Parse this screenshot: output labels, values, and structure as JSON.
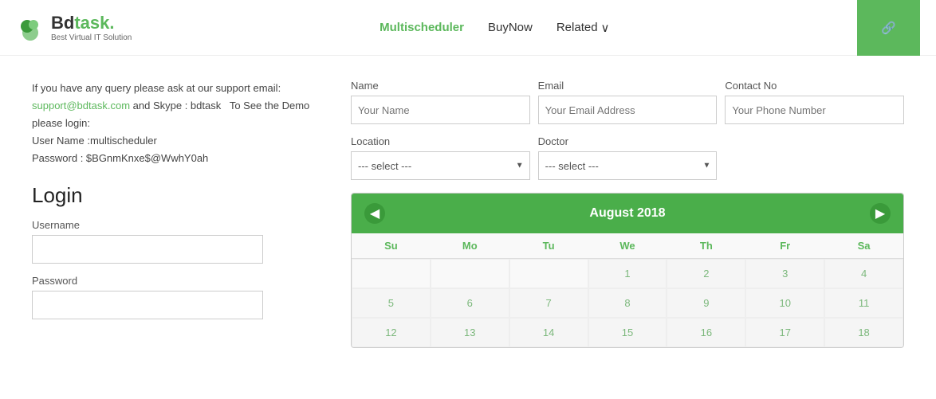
{
  "header": {
    "logo_name": "Bdtask.",
    "logo_tagline": "Best Virtual IT Solution",
    "nav_items": [
      {
        "id": "multischeduler",
        "label": "Multischeduler",
        "active": true
      },
      {
        "id": "buynow",
        "label": "BuyNow",
        "active": false
      },
      {
        "id": "related",
        "label": "Related",
        "active": false,
        "has_dropdown": true
      }
    ],
    "cta_icon": "🔗"
  },
  "left": {
    "info": {
      "line1": "If you have any query please ask at our support email:",
      "email": "support@bdtask.com",
      "line2": "and Skype : bdtask  To See the Demo please login:",
      "username_label": "User Name :multischeduler",
      "password_label": "Password : $BGnmKnxe$@WwhY0ah"
    },
    "login": {
      "title": "Login",
      "username_label": "Username",
      "username_placeholder": "",
      "password_label": "Password",
      "password_placeholder": ""
    }
  },
  "right": {
    "contact_form": {
      "name_label": "Name",
      "name_placeholder": "Your Name",
      "email_label": "Email",
      "email_placeholder": "Your Email Address",
      "contact_label": "Contact No",
      "contact_placeholder": "Your Phone Number",
      "location_label": "Location",
      "location_placeholder": "--- select ---",
      "doctor_label": "Doctor",
      "doctor_placeholder": "--- select ---"
    },
    "calendar": {
      "month_year": "August 2018",
      "days": [
        "Su",
        "Mo",
        "Tu",
        "We",
        "Th",
        "Fr",
        "Sa"
      ],
      "weeks": [
        [
          "",
          "",
          "",
          "1",
          "2",
          "3",
          "4"
        ],
        [
          "5",
          "6",
          "7",
          "8",
          "9",
          "10",
          "11"
        ],
        [
          "12",
          "13",
          "14",
          "15",
          "16",
          "17",
          "18"
        ]
      ]
    }
  }
}
